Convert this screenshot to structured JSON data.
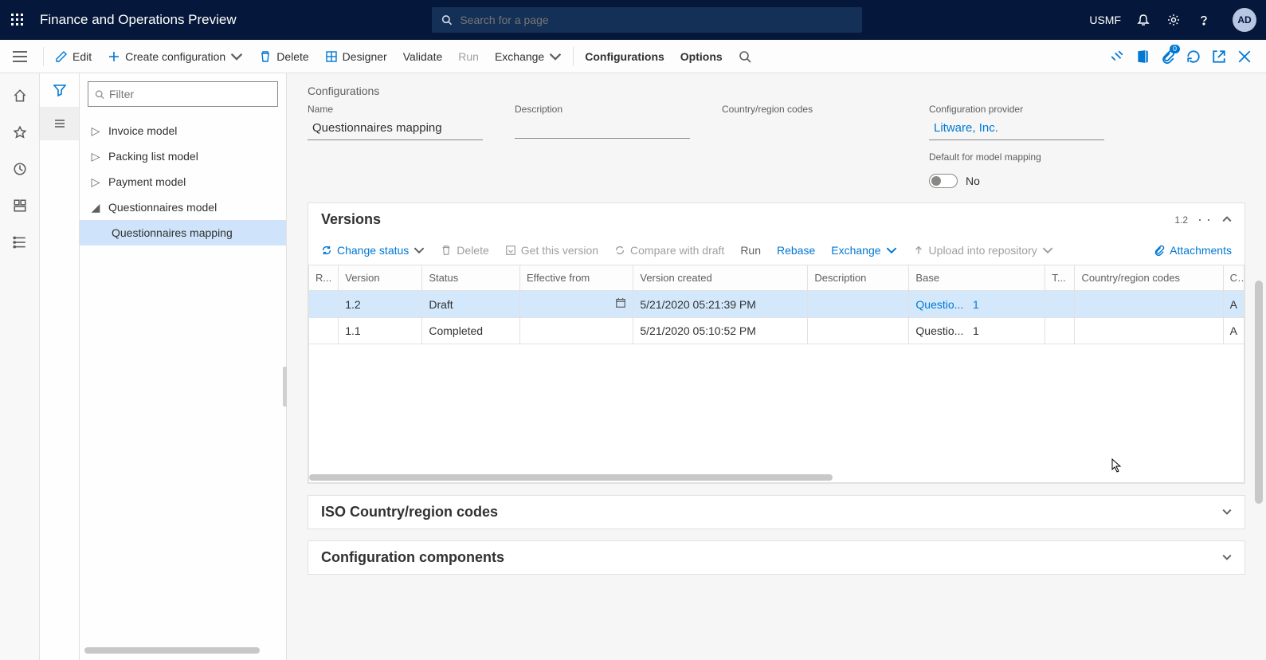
{
  "banner": {
    "title": "Finance and Operations Preview",
    "search_placeholder": "Search for a page",
    "company": "USMF",
    "avatar": "AD"
  },
  "actions": {
    "edit": "Edit",
    "create": "Create configuration",
    "delete": "Delete",
    "designer": "Designer",
    "validate": "Validate",
    "run": "Run",
    "exchange": "Exchange",
    "configurations": "Configurations",
    "options": "Options",
    "attach_count": "0"
  },
  "tree": {
    "filter_placeholder": "Filter",
    "items": [
      {
        "label": "Invoice model",
        "expanded": false
      },
      {
        "label": "Packing list model",
        "expanded": false
      },
      {
        "label": "Payment model",
        "expanded": false
      },
      {
        "label": "Questionnaires model",
        "expanded": true,
        "children": [
          {
            "label": "Questionnaires mapping",
            "selected": true
          }
        ]
      }
    ]
  },
  "crumb": "Configurations",
  "fields": {
    "name_label": "Name",
    "name_value": "Questionnaires mapping",
    "description_label": "Description",
    "description_value": "",
    "country_label": "Country/region codes",
    "country_value": "",
    "provider_label": "Configuration provider",
    "provider_value": "Litware, Inc.",
    "default_label": "Default for model mapping",
    "default_value": "No"
  },
  "versions": {
    "title": "Versions",
    "badge": "1.2",
    "toolbar": {
      "change_status": "Change status",
      "delete": "Delete",
      "get": "Get this version",
      "compare": "Compare with draft",
      "run": "Run",
      "rebase": "Rebase",
      "exchange": "Exchange",
      "upload": "Upload into repository",
      "attachments": "Attachments"
    },
    "columns": {
      "r": "R...",
      "version": "Version",
      "status": "Status",
      "effective": "Effective from",
      "created": "Version created",
      "description": "Description",
      "base": "Base",
      "t": "T...",
      "country": "Country/region codes",
      "c": "C…"
    },
    "rows": [
      {
        "version": "1.2",
        "status": "Draft",
        "effective": "",
        "created": "5/21/2020 05:21:39 PM",
        "description": "",
        "base": "Questio...",
        "base_n": "1",
        "t": "",
        "country": "",
        "c": "A",
        "selected": true
      },
      {
        "version": "1.1",
        "status": "Completed",
        "effective": "",
        "created": "5/21/2020 05:10:52 PM",
        "description": "",
        "base": "Questio...",
        "base_n": "1",
        "t": "",
        "country": "",
        "c": "A",
        "selected": false
      }
    ]
  },
  "section_iso": "ISO Country/region codes",
  "section_components": "Configuration components"
}
